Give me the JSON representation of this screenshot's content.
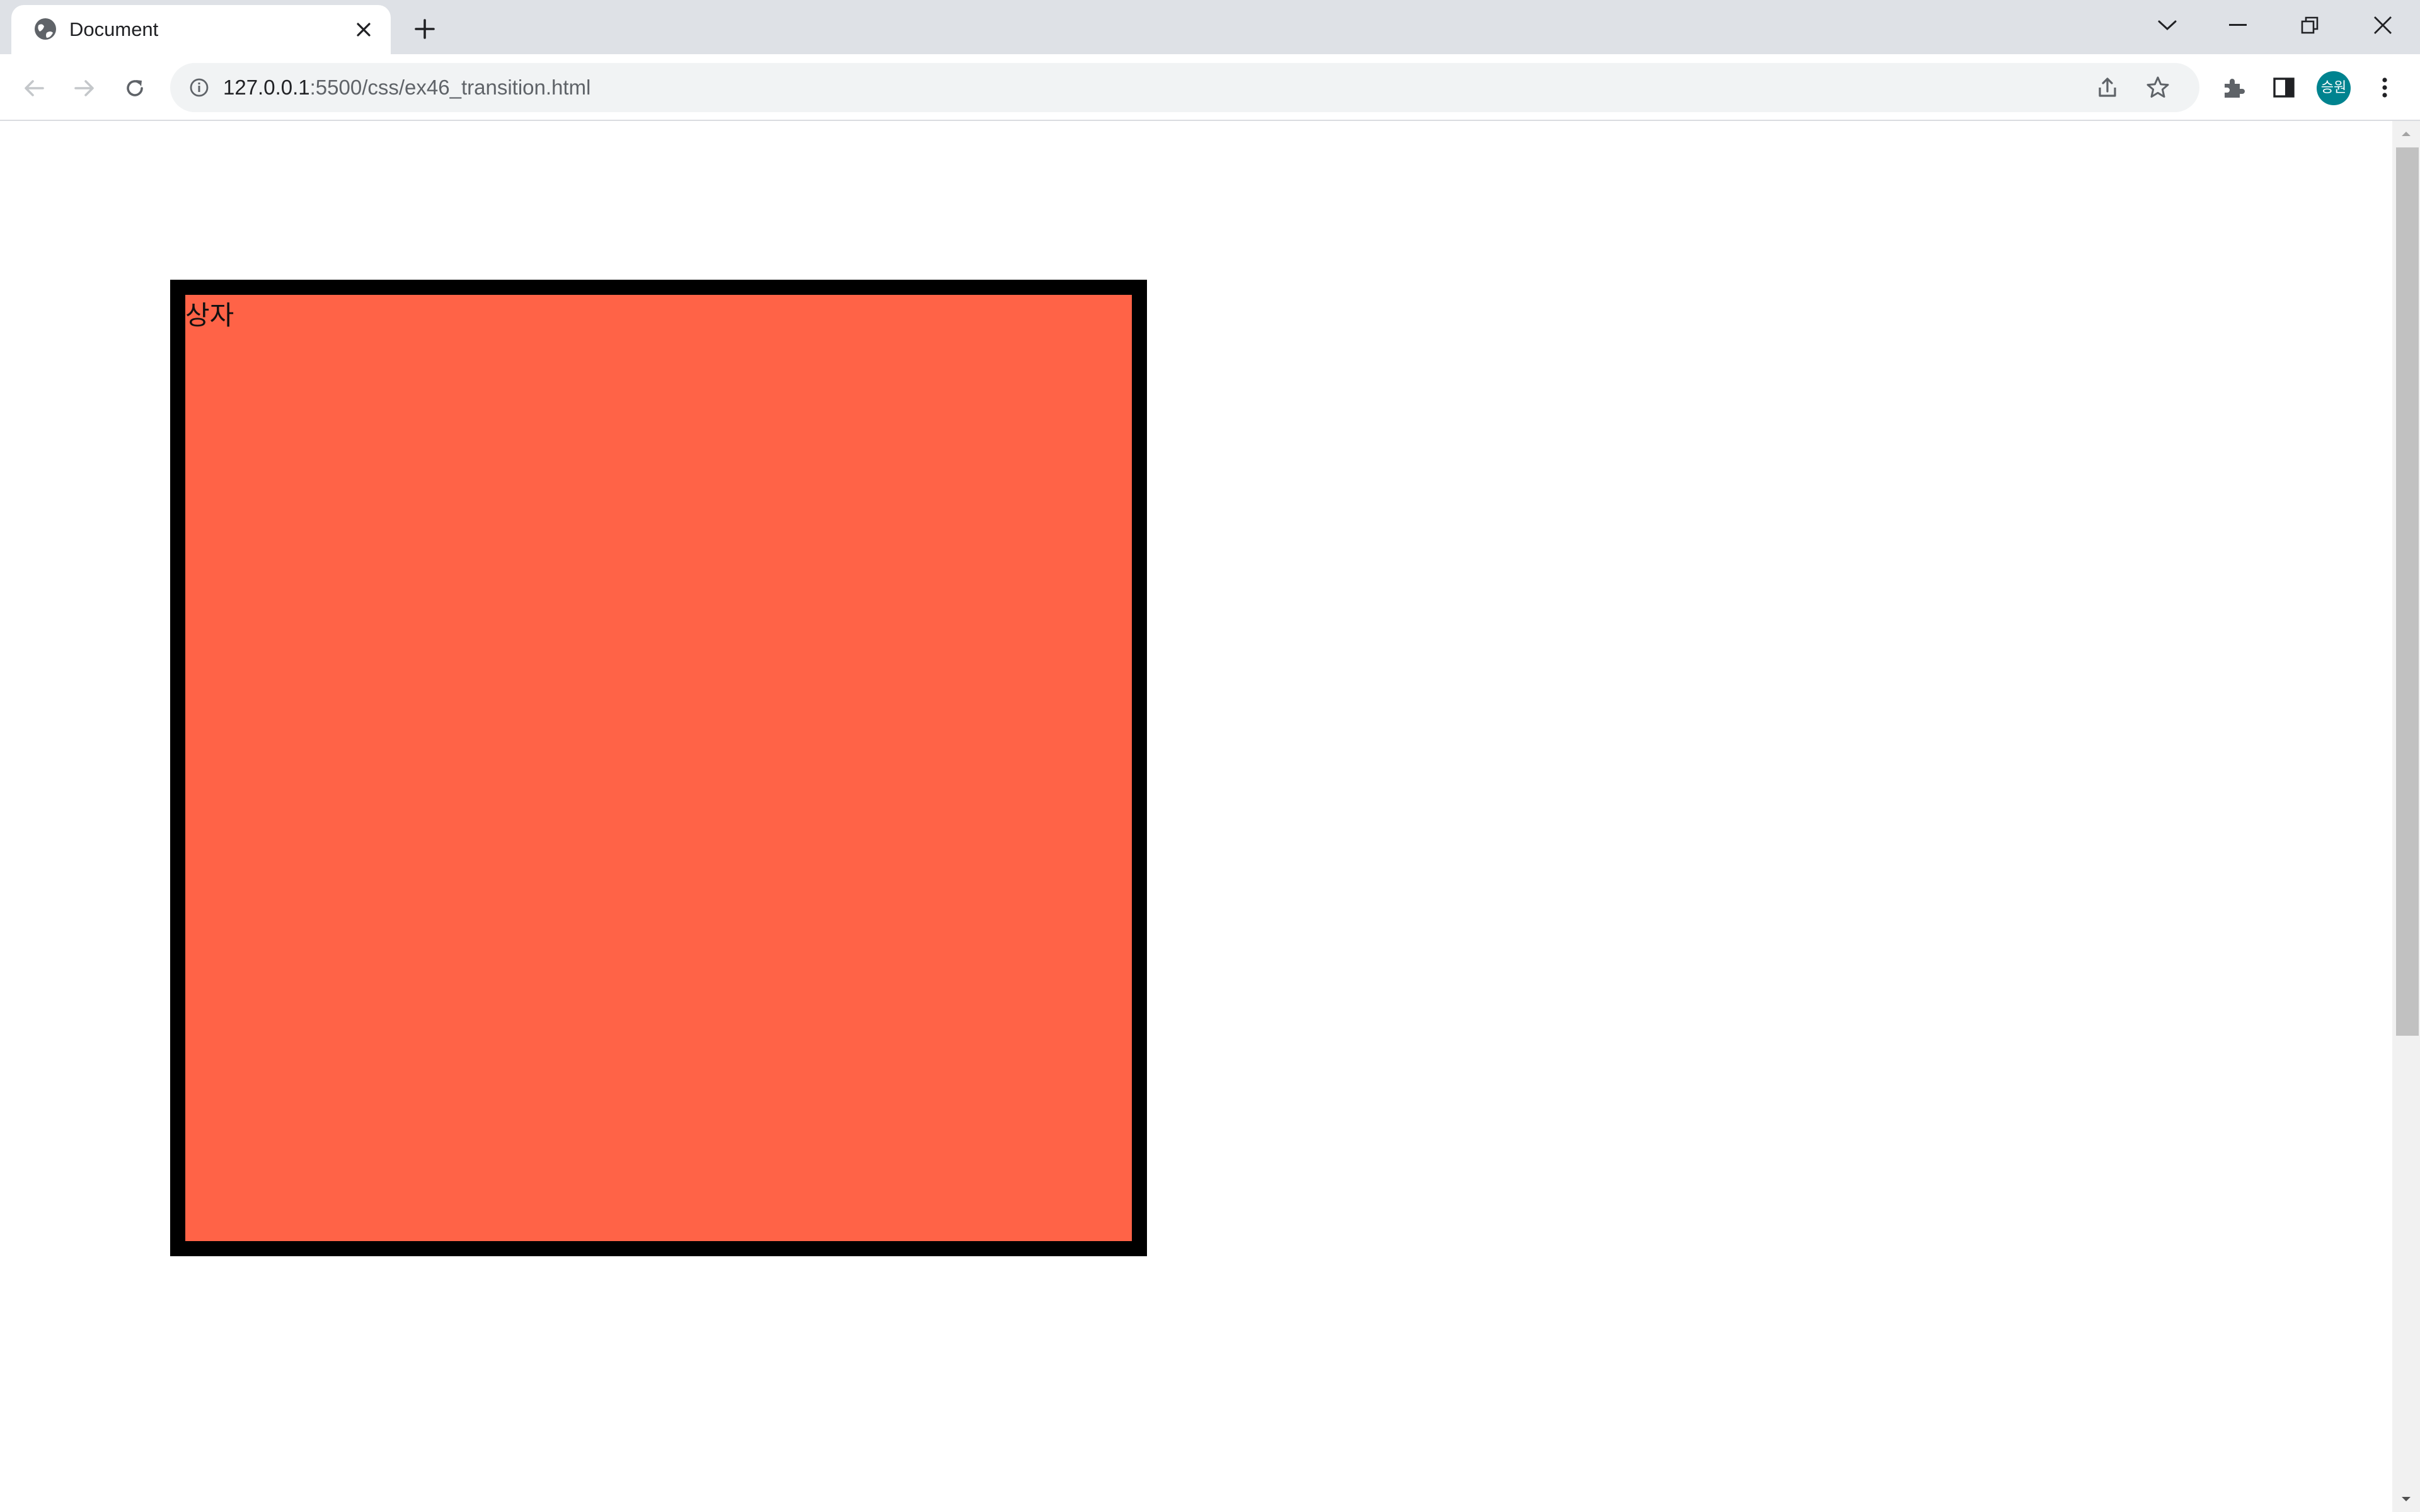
{
  "browser": {
    "tab": {
      "title": "Document",
      "favicon_icon": "globe-icon",
      "close_icon": "close-icon"
    },
    "new_tab_icon": "plus-icon",
    "window_controls": {
      "tab_search_icon": "chevron-down-icon",
      "minimize_icon": "minimize-icon",
      "restore_icon": "restore-icon",
      "close_icon": "close-icon"
    },
    "toolbar": {
      "back_icon": "arrow-left-icon",
      "forward_icon": "arrow-right-icon",
      "reload_icon": "reload-icon",
      "site_info_icon": "info-icon",
      "url_host": "127.0.0.1",
      "url_path": ":5500/css/ex46_transition.html",
      "share_icon": "share-icon",
      "bookmark_icon": "star-icon",
      "extensions_icon": "puzzle-icon",
      "side_panel_icon": "side-panel-icon",
      "profile_initials": "승원",
      "menu_icon": "more-vert-icon"
    }
  },
  "page": {
    "box_label": "상자"
  },
  "colors": {
    "box_fill": "#ff6347",
    "box_border": "#000000",
    "profile_avatar": "#00838f",
    "tab_strip": "#dee1e6"
  }
}
